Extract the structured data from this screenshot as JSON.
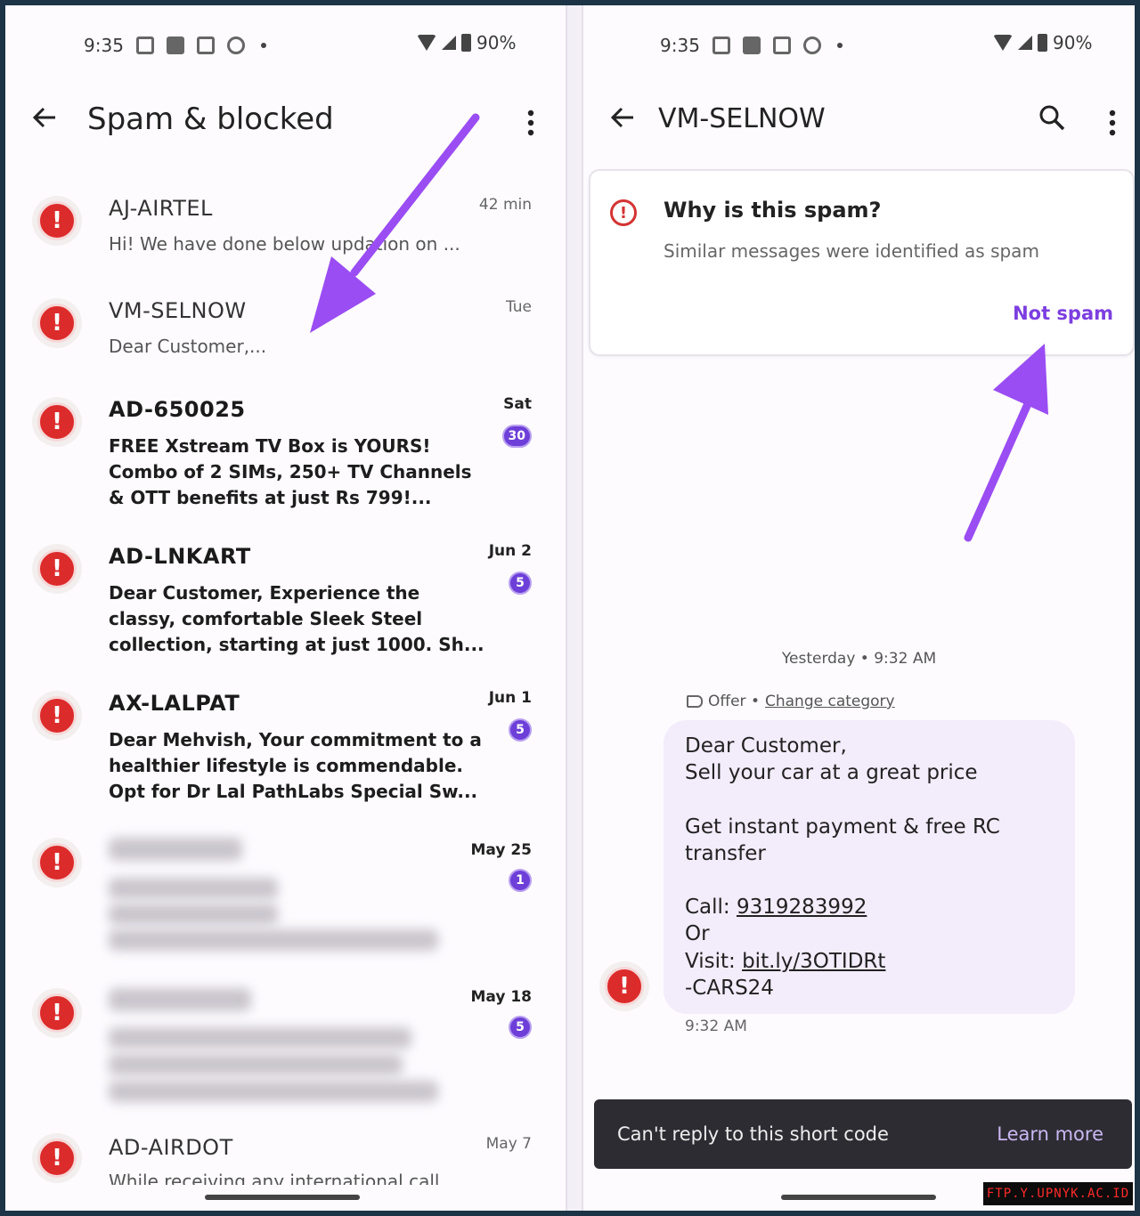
{
  "status": {
    "time": "9:35",
    "battery": "90%"
  },
  "left": {
    "title": "Spam & blocked",
    "conversations": [
      {
        "name": "AJ-AIRTEL",
        "preview": "Hi! We have done below updation on ...",
        "time": "42 min",
        "unread": false,
        "badge": ""
      },
      {
        "name": "VM-SELNOW",
        "preview": "Dear Customer,...",
        "time": "Tue",
        "unread": false,
        "badge": ""
      },
      {
        "name": "AD-650025",
        "preview": "FREE Xstream TV Box is YOURS! Combo of 2 SIMs, 250+ TV Channels & OTT benefits at just Rs 799!...",
        "time": "Sat",
        "unread": true,
        "badge": "30"
      },
      {
        "name": "AD-LNKART",
        "preview": "Dear Customer, Experience the classy, comfortable Sleek Steel collection, starting at just 1000. Sh...",
        "time": "Jun 2",
        "unread": true,
        "badge": "5"
      },
      {
        "name": "AX-LALPAT",
        "preview": "Dear Mehvish, Your commitment to a healthier lifestyle is commendable. Opt for Dr Lal PathLabs Special Sw...",
        "time": "Jun 1",
        "unread": true,
        "badge": "5"
      },
      {
        "name": "",
        "preview": "",
        "time": "May 25",
        "unread": true,
        "badge": "1",
        "blurred": true
      },
      {
        "name": "",
        "preview": "",
        "time": "May 18",
        "unread": true,
        "badge": "5",
        "blurred": true
      },
      {
        "name": "AD-AIRDOT",
        "preview": "While receiving any international call",
        "time": "May 7",
        "unread": false,
        "badge": ""
      }
    ]
  },
  "right": {
    "title": "VM-SELNOW",
    "spam_card": {
      "title": "Why is this spam?",
      "subtitle": "Similar messages were identified as spam",
      "action": "Not spam"
    },
    "timestamp": "Yesterday • 9:32 AM",
    "category": {
      "label": "Offer •",
      "link": "Change category"
    },
    "message": {
      "line1": "Dear Customer,",
      "line2": "Sell your car at a great price",
      "line3": "Get instant payment & free RC transfer",
      "call_label": "Call: ",
      "phone": "9319283992",
      "or": "Or",
      "visit_label": "Visit: ",
      "url": "bit.ly/3OTIDRt",
      "signature": "-CARS24",
      "time": "9:32 AM"
    },
    "snackbar": {
      "text": "Can't reply to this short code",
      "action": "Learn more"
    }
  },
  "watermark": "FTP.Y.UPNYK.AC.ID",
  "colors": {
    "accent": "#7c3ee0",
    "alert": "#dc2b2b",
    "arrow": "#9a4df2"
  }
}
